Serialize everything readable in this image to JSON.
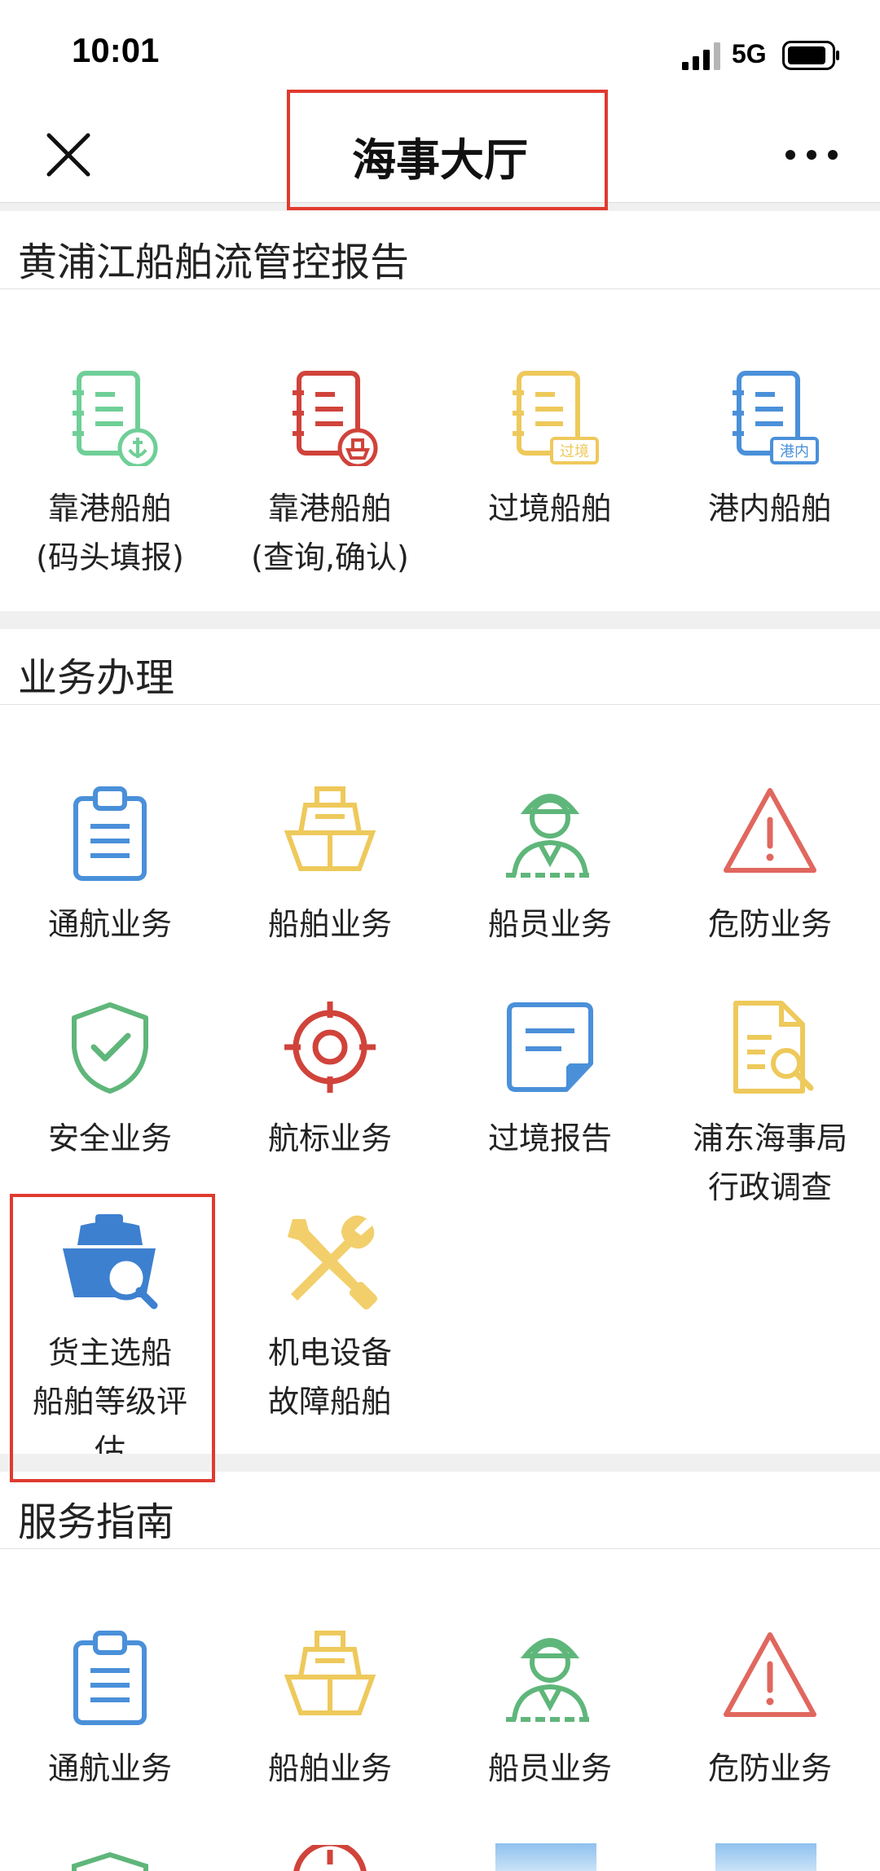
{
  "status_bar": {
    "time": "10:01",
    "network": "5G"
  },
  "nav": {
    "title": "海事大厅"
  },
  "sections": [
    {
      "title": "黄浦江船舶流管控报告",
      "items": [
        {
          "label": "靠港船舶\n(码头填报)",
          "icon": "berthing-report-anchor-icon",
          "color": "#6fcf97"
        },
        {
          "label": "靠港船舶\n(查询,确认)",
          "icon": "berthing-query-ship-icon",
          "color": "#d0433a"
        },
        {
          "label": "过境船舶",
          "icon": "transit-ship-icon",
          "color": "#eec95b",
          "badge": "过境"
        },
        {
          "label": "港内船舶",
          "icon": "in-port-ship-icon",
          "color": "#4a90d9",
          "badge": "港内"
        }
      ]
    },
    {
      "title": "业务办理",
      "items": [
        {
          "label": "通航业务",
          "icon": "clipboard-icon",
          "color": "#4a90d9"
        },
        {
          "label": "船舶业务",
          "icon": "ship-icon",
          "color": "#eec95b"
        },
        {
          "label": "船员业务",
          "icon": "crew-icon",
          "color": "#5fb67a"
        },
        {
          "label": "危防业务",
          "icon": "warning-icon",
          "color": "#e0675e"
        },
        {
          "label": "安全业务",
          "icon": "shield-check-icon",
          "color": "#5fb67a"
        },
        {
          "label": "航标业务",
          "icon": "target-icon",
          "color": "#d0433a"
        },
        {
          "label": "过境报告",
          "icon": "note-icon",
          "color": "#4a90d9"
        },
        {
          "label": "浦东海事局\n行政调查",
          "icon": "document-search-icon",
          "color": "#eec95b"
        },
        {
          "label": "货主选船\n船舶等级评\n估",
          "icon": "ship-search-icon",
          "color": "#3d80cf"
        },
        {
          "label": "机电设备\n故障船舶",
          "icon": "wrench-screwdriver-icon",
          "color": "#f2cf6b"
        }
      ]
    },
    {
      "title": "服务指南",
      "items": [
        {
          "label": "通航业务",
          "icon": "clipboard-icon",
          "color": "#4a90d9"
        },
        {
          "label": "船舶业务",
          "icon": "ship-icon",
          "color": "#eec95b"
        },
        {
          "label": "船员业务",
          "icon": "crew-icon",
          "color": "#5fb67a"
        },
        {
          "label": "危防业务",
          "icon": "warning-icon",
          "color": "#e0675e"
        }
      ]
    }
  ]
}
